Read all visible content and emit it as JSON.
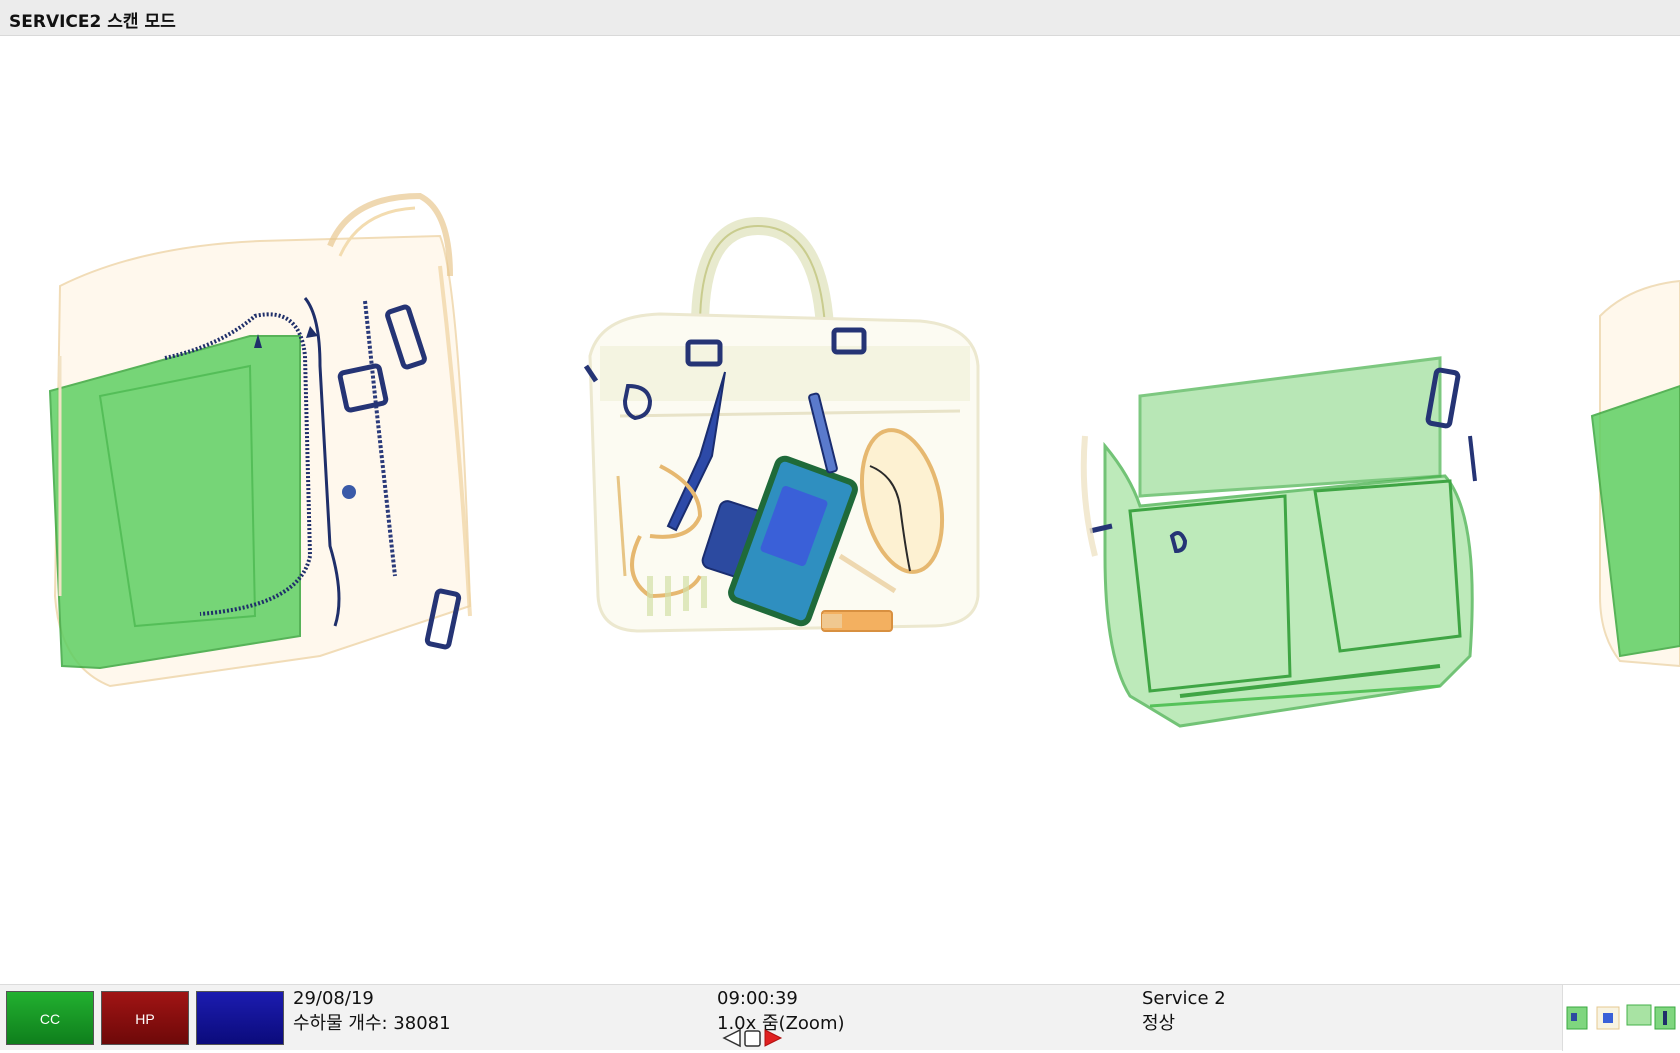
{
  "window": {
    "title": "SERVICE2 스캔 모드"
  },
  "status_bar": {
    "buttons": [
      {
        "label": "CC",
        "color": "#1a9a28"
      },
      {
        "label": "HP",
        "color": "#8a0f0f"
      },
      {
        "label": "",
        "color": "#1414a0"
      }
    ],
    "date": "29/08/19",
    "baggage_count_label": "수하물 개수: 38081",
    "time": "09:00:39",
    "zoom_label": "1.0x 줌(Zoom)",
    "service_name": "Service 2",
    "status": "정상"
  },
  "icons": {
    "nav_prev": "triangle-left-icon",
    "nav_stop": "square-icon",
    "nav_next": "triangle-right-icon"
  }
}
